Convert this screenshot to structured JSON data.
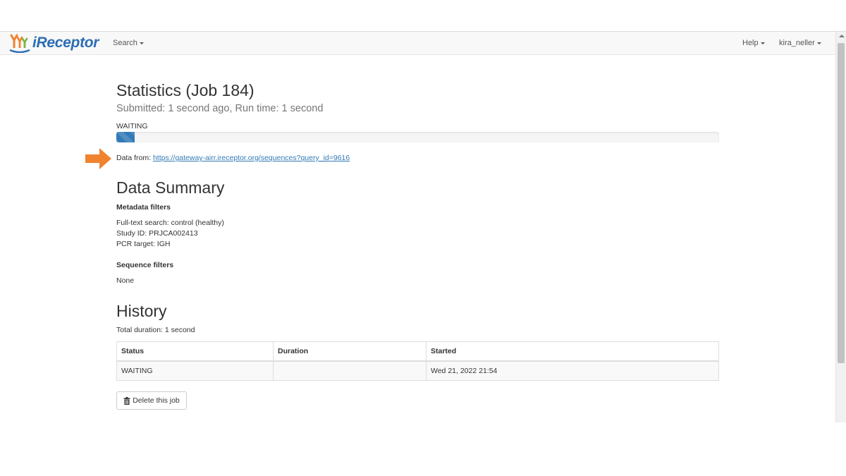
{
  "navbar": {
    "brand": "iReceptor",
    "search_label": "Search",
    "help_label": "Help",
    "user_label": "kira_neller"
  },
  "job": {
    "title": "Statistics (Job 184)",
    "subtitle": "Submitted: 1 second ago, Run time: 1 second",
    "status": "WAITING",
    "progress_fraction": 0.03,
    "data_from_label": "Data from:",
    "data_from_url": "https://gateway-airr.ireceptor.org/sequences?query_id=9616"
  },
  "summary": {
    "heading": "Data Summary",
    "metadata_heading": "Metadata filters",
    "metadata_filters": [
      "Full-text search: control (healthy)",
      "Study ID: PRJCA002413",
      "PCR target: IGH"
    ],
    "sequence_heading": "Sequence filters",
    "sequence_filters": "None"
  },
  "history": {
    "heading": "History",
    "total_duration": "Total duration: 1 second",
    "columns": [
      "Status",
      "Duration",
      "Started"
    ],
    "rows": [
      [
        "WAITING",
        "",
        "Wed 21, 2022 21:54"
      ]
    ]
  },
  "actions": {
    "delete_label": "Delete this job"
  },
  "colors": {
    "brand": "#2b6db4",
    "link": "#337ab7",
    "progress": "#337ab7",
    "annotation_arrow": "#f0832f"
  },
  "icons": {
    "logo": "ireceptor-logo-icon",
    "arrow": "arrow-right-icon",
    "trash": "trash-icon"
  }
}
